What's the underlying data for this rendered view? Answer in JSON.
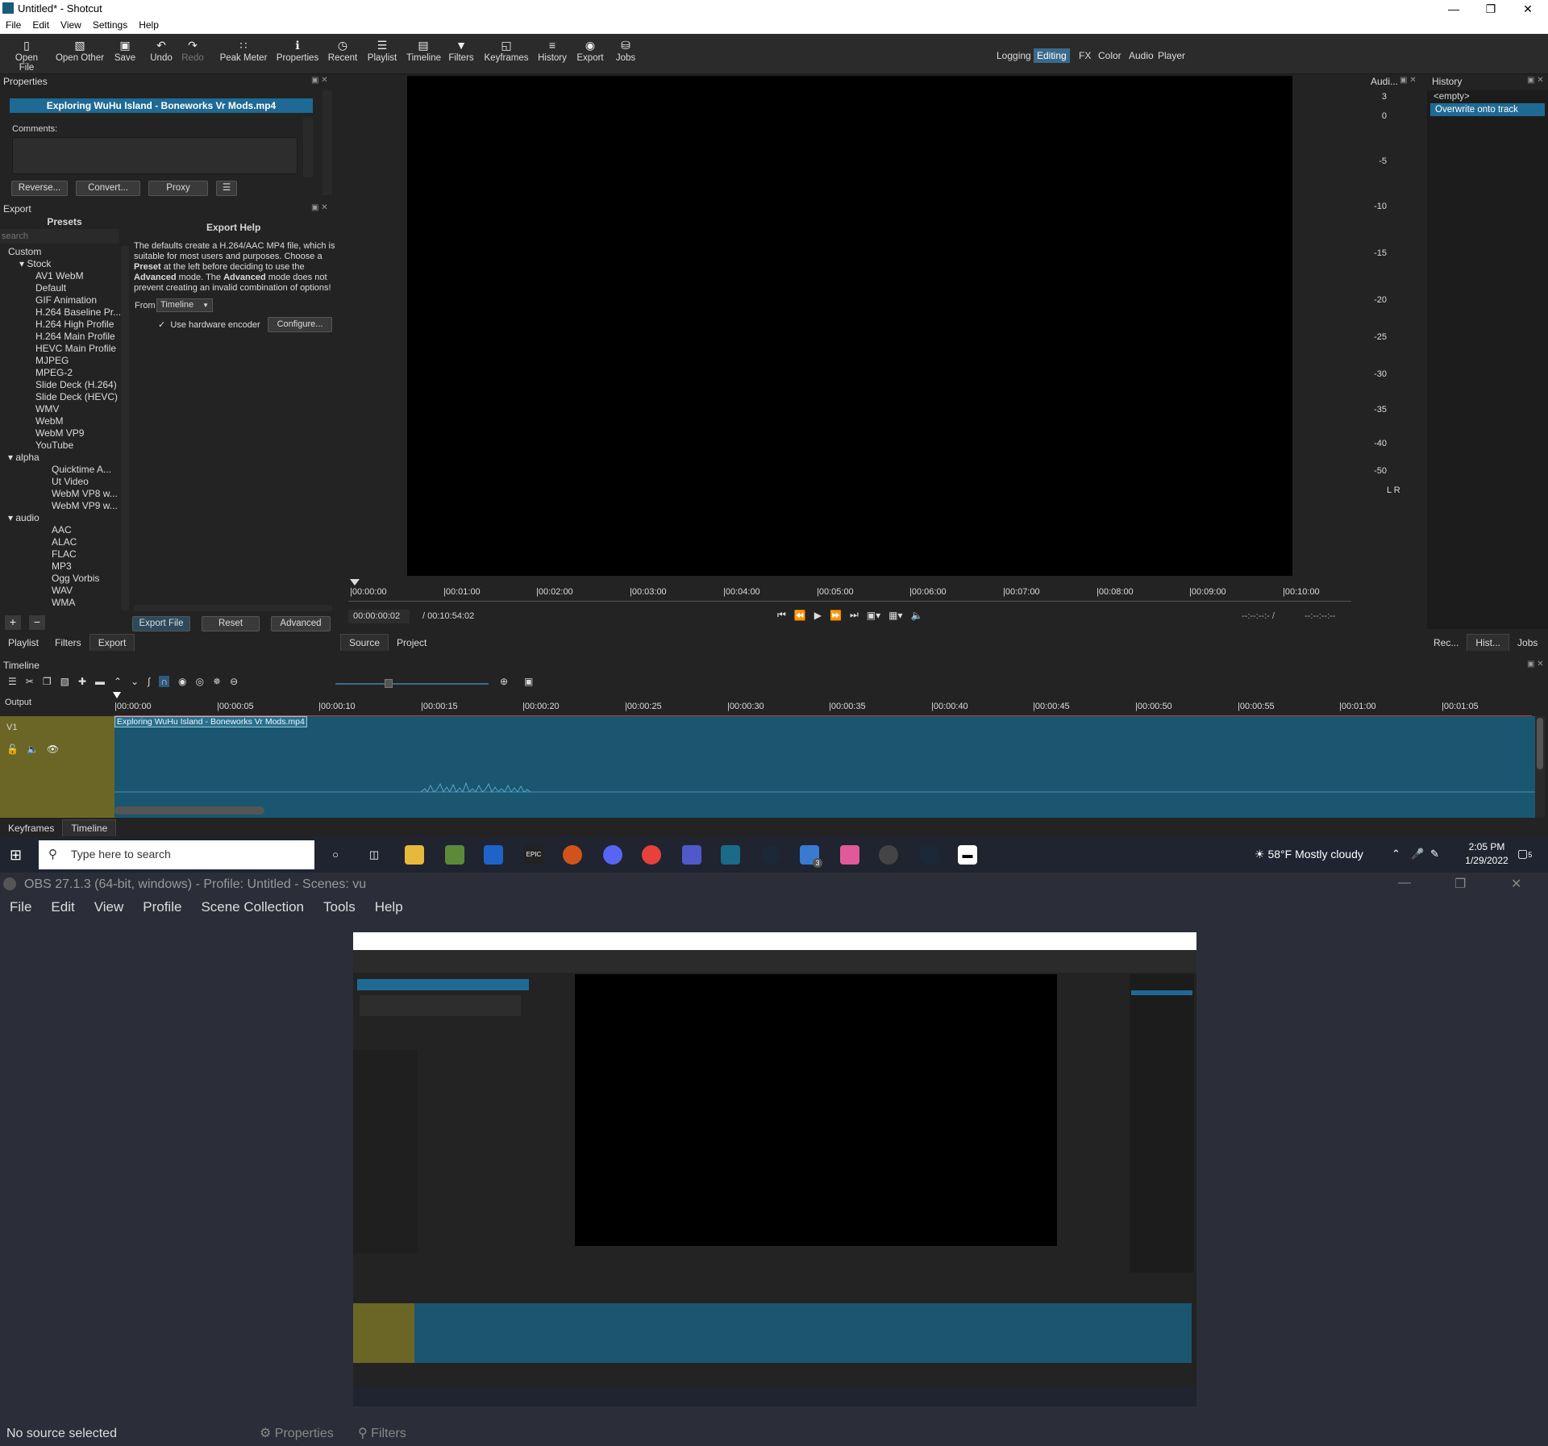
{
  "shotcut": {
    "window_title": "Untitled* - Shotcut",
    "menu": [
      "File",
      "Edit",
      "View",
      "Settings",
      "Help"
    ],
    "toolbar": [
      {
        "label": "Open File",
        "icon": "open-file-icon"
      },
      {
        "label": "Open Other",
        "icon": "open-other-icon"
      },
      {
        "label": "Save",
        "icon": "save-icon"
      },
      {
        "label": "Undo",
        "icon": "undo-icon"
      },
      {
        "label": "Redo",
        "icon": "redo-icon"
      },
      {
        "label": "Peak Meter",
        "icon": "peak-meter-icon"
      },
      {
        "label": "Properties",
        "icon": "properties-icon"
      },
      {
        "label": "Recent",
        "icon": "recent-icon"
      },
      {
        "label": "Playlist",
        "icon": "playlist-icon"
      },
      {
        "label": "Timeline",
        "icon": "timeline-icon"
      },
      {
        "label": "Filters",
        "icon": "filters-icon"
      },
      {
        "label": "Keyframes",
        "icon": "keyframes-icon"
      },
      {
        "label": "History",
        "icon": "history-icon"
      },
      {
        "label": "Export",
        "icon": "export-icon"
      },
      {
        "label": "Jobs",
        "icon": "jobs-icon"
      }
    ],
    "layouts": [
      "Logging",
      "Editing",
      "FX",
      "Color",
      "Audio",
      "Player"
    ],
    "active_layout": "Editing",
    "properties": {
      "header": "Properties",
      "clip_name": "Exploring WuHu Island - Boneworks Vr Mods.mp4",
      "comments_label": "Comments:",
      "buttons": [
        "Reverse...",
        "Convert...",
        "Proxy",
        "☰"
      ]
    },
    "export": {
      "header": "Export",
      "presets_label": "Presets",
      "search_placeholder": "search",
      "tree": [
        {
          "label": "Custom",
          "level": 1
        },
        {
          "label": "Stock",
          "level": 0,
          "expanded": true
        },
        {
          "label": "AV1 WebM",
          "level": 2
        },
        {
          "label": "Default",
          "level": 2
        },
        {
          "label": "GIF Animation",
          "level": 2
        },
        {
          "label": "H.264 Baseline Pr...",
          "level": 2
        },
        {
          "label": "H.264 High Profile",
          "level": 2
        },
        {
          "label": "H.264 Main Profile",
          "level": 2
        },
        {
          "label": "HEVC Main Profile",
          "level": 2
        },
        {
          "label": "MJPEG",
          "level": 2
        },
        {
          "label": "MPEG-2",
          "level": 2
        },
        {
          "label": "Slide Deck (H.264)",
          "level": 2
        },
        {
          "label": "Slide Deck (HEVC)",
          "level": 2
        },
        {
          "label": "WMV",
          "level": 2
        },
        {
          "label": "WebM",
          "level": 2
        },
        {
          "label": "WebM VP9",
          "level": 2
        },
        {
          "label": "YouTube",
          "level": 2
        },
        {
          "label": "alpha",
          "level": 1,
          "expanded": true
        },
        {
          "label": "Quicktime A...",
          "level": 3
        },
        {
          "label": "Ut Video",
          "level": 3
        },
        {
          "label": "WebM VP8 w...",
          "level": 3
        },
        {
          "label": "WebM VP9 w...",
          "level": 3
        },
        {
          "label": "audio",
          "level": 1,
          "expanded": true
        },
        {
          "label": "AAC",
          "level": 3
        },
        {
          "label": "ALAC",
          "level": 3
        },
        {
          "label": "FLAC",
          "level": 3
        },
        {
          "label": "MP3",
          "level": 3
        },
        {
          "label": "Ogg Vorbis",
          "level": 3
        },
        {
          "label": "WAV",
          "level": 3
        },
        {
          "label": "WMA",
          "level": 3
        }
      ],
      "help_title": "Export Help",
      "help_text_1": "The defaults create a H.264/AAC MP4 file, which is suitable for most users and purposes. Choose a",
      "help_bold_1": "Preset",
      "help_text_2": "at the left before deciding to use the",
      "help_bold_2": "Advanced",
      "help_text_3": "mode. The",
      "help_bold_3": "Advanced",
      "help_text_4": "mode does not prevent creating an invalid combination of options!",
      "from_label": "From",
      "from_value": "Timeline",
      "hw_encoder_label": "Use hardware encoder",
      "hw_encoder_checked": true,
      "configure_button": "Configure...",
      "export_file_button": "Export File",
      "reset_button": "Reset",
      "advanced_button": "Advanced",
      "bottom_tabs": [
        "Playlist",
        "Filters",
        "Export"
      ],
      "active_tab": "Export"
    },
    "player": {
      "ruler": [
        "00:00:00",
        "00:01:00",
        "00:02:00",
        "00:03:00",
        "00:04:00",
        "00:05:00",
        "00:06:00",
        "00:07:00",
        "00:08:00",
        "00:09:00",
        "00:10:00"
      ],
      "current_time": "00:00:00:02",
      "total_time": "/ 00:10:54:02",
      "in_point": "--:--:--:- /",
      "out_point": "--:--:--:--",
      "tabs": [
        "Source",
        "Project"
      ],
      "active_tab": "Source"
    },
    "audio_meter": {
      "header": "Audi...",
      "scale": [
        "3",
        "0",
        "-5",
        "-10",
        "-15",
        "-20",
        "-25",
        "-30",
        "-35",
        "-40",
        "-50"
      ],
      "channels": "L R"
    },
    "history": {
      "header": "History",
      "items": [
        "<empty>",
        "Overwrite onto track"
      ],
      "selected_index": 1,
      "bottom_tabs": [
        "Rec...",
        "Hist...",
        "Jobs"
      ],
      "active_tab": "Hist..."
    },
    "timeline": {
      "header": "Timeline",
      "output_label": "Output",
      "track_name": "V1",
      "ruler": [
        "00:00:00",
        "00:00:05",
        "00:00:10",
        "00:00:15",
        "00:00:20",
        "00:00:25",
        "00:00:30",
        "00:00:35",
        "00:00:40",
        "00:00:45",
        "00:00:50",
        "00:00:55",
        "00:01:00",
        "00:01:05"
      ],
      "clip_name": "Exploring WuHu Island - Boneworks Vr Mods.mp4",
      "bottom_tabs": [
        "Keyframes",
        "Timeline"
      ],
      "active_tab": "Timeline"
    }
  },
  "taskbar": {
    "search_placeholder": "Type here to search",
    "weather": "58°F  Mostly cloudy",
    "time": "2:05 PM",
    "date": "1/29/2022",
    "notification_count": "5",
    "mail_badge": "3"
  },
  "obs": {
    "window_title": "OBS 27.1.3 (64-bit, windows) - Profile: Untitled - Scenes: vu",
    "menu": [
      "File",
      "Edit",
      "View",
      "Profile",
      "Scene Collection",
      "Tools",
      "Help"
    ],
    "status_text": "No source selected",
    "properties_button": "Properties",
    "filters_button": "Filters"
  },
  "colors": {
    "accent": "#1e6a94",
    "track_bg": "#1a5670",
    "track_header": "#6b6626",
    "playhead": "#e04040"
  }
}
